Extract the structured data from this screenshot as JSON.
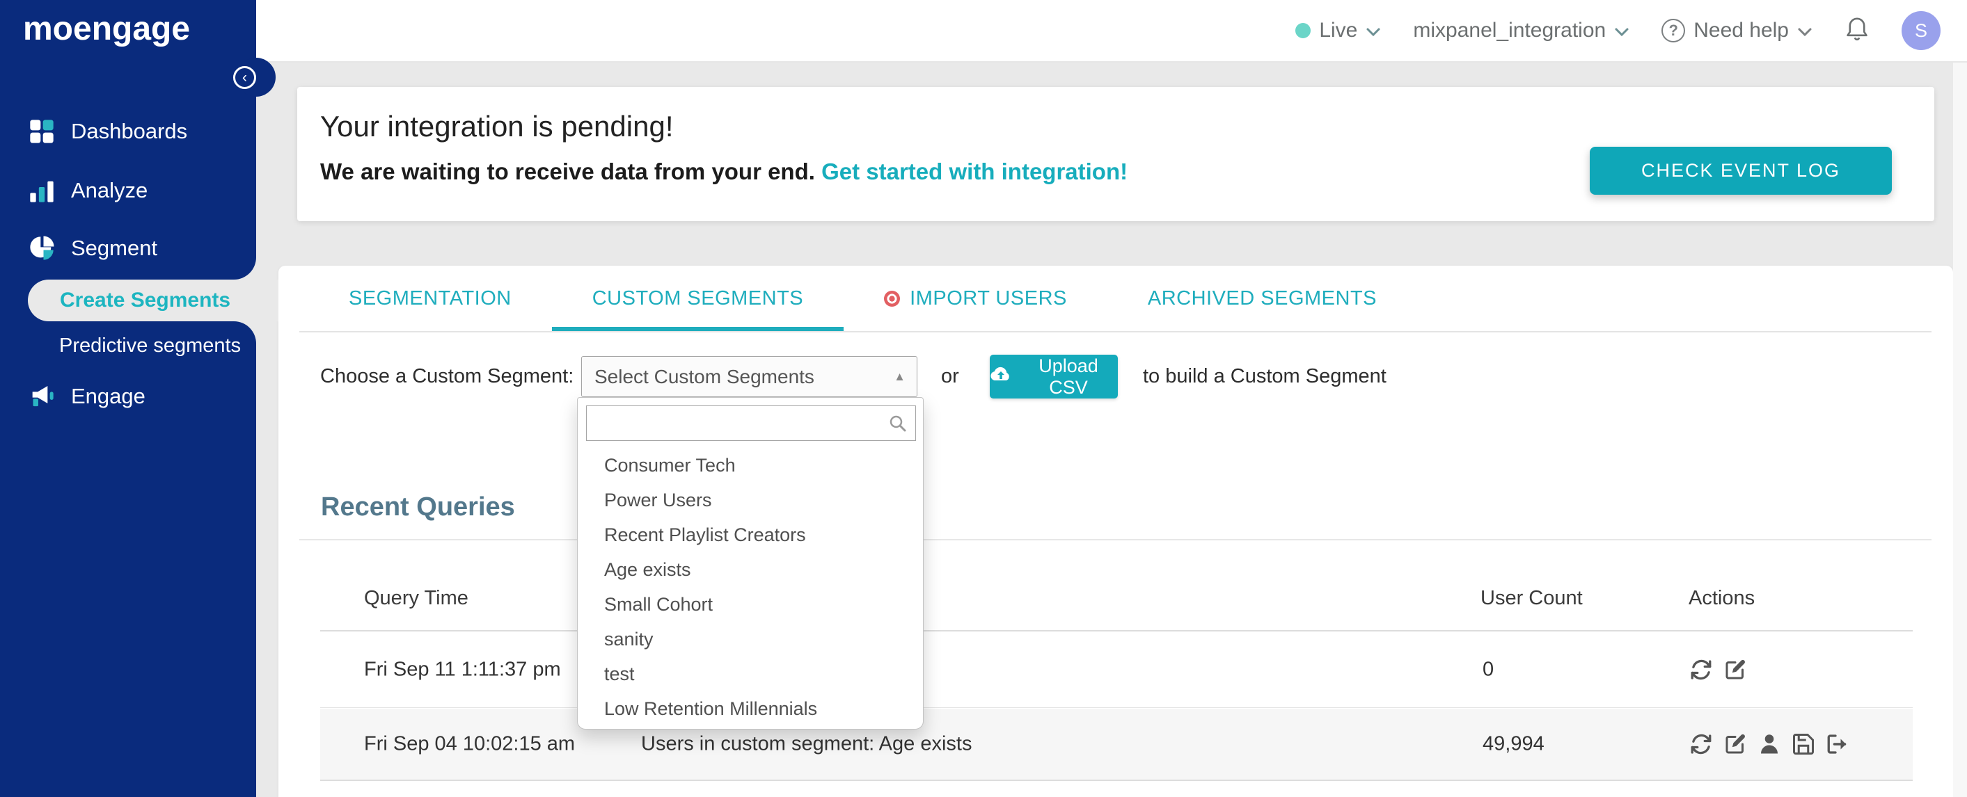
{
  "colors": {
    "sidebar_navy": "#0a2b7d",
    "accent_teal": "#17adbc",
    "button_teal": "#0fa7b8",
    "live_dot": "#6bd5c8",
    "avatar_bg": "#99a1ec",
    "alert_red": "#e25f62",
    "heading_slate": "#53788c"
  },
  "sidebar": {
    "logo_text": "moengage",
    "items": [
      {
        "label": "Dashboards",
        "icon": "dashboard-grid-icon"
      },
      {
        "label": "Analyze",
        "icon": "bar-chart-icon"
      },
      {
        "label": "Segment",
        "icon": "pie-chart-icon"
      }
    ],
    "segment_submenu": [
      {
        "label": "Create Segments",
        "active": true
      },
      {
        "label": "Predictive segments",
        "active": false
      }
    ],
    "items_bottom": [
      {
        "label": "Engage",
        "icon": "megaphone-icon"
      }
    ],
    "collapse_glyph": "‹"
  },
  "topbar": {
    "environment": "Live",
    "workspace": "mixpanel_integration",
    "help_label": "Need help",
    "help_glyph": "?",
    "avatar_initial": "S"
  },
  "banner": {
    "title": "Your integration is pending!",
    "message": "We are waiting to receive data from your end.",
    "link_text": "Get started with integration!",
    "button_label": "CHECK EVENT LOG"
  },
  "tabs": [
    {
      "label": "SEGMENTATION",
      "active": false,
      "has_alert_dot": false
    },
    {
      "label": "CUSTOM SEGMENTS",
      "active": true,
      "has_alert_dot": false
    },
    {
      "label": "IMPORT USERS",
      "active": false,
      "has_alert_dot": true
    },
    {
      "label": "ARCHIVED SEGMENTS",
      "active": false,
      "has_alert_dot": false
    }
  ],
  "picker": {
    "label": "Choose a Custom Segment:",
    "selected_value": "Select Custom Segments",
    "caret_glyph": "▲",
    "or_text": "or",
    "upload_label": "Upload CSV",
    "helper_text": "to build a Custom Segment",
    "search_value": "",
    "search_placeholder": "",
    "options": [
      "Consumer Tech",
      "Power Users",
      "Recent Playlist Creators",
      "Age exists",
      "Small Cohort",
      "sanity",
      "test",
      "Low Retention Millennials"
    ]
  },
  "recent_queries": {
    "heading": "Recent Queries",
    "columns": {
      "time": "Query Time",
      "count": "User Count",
      "actions": "Actions"
    },
    "rows": [
      {
        "time": "Fri Sep 11 1:11:37 pm",
        "description": "",
        "count": "0",
        "actions": [
          "refresh-icon",
          "edit-icon"
        ]
      },
      {
        "time": "Fri Sep 04 10:02:15 am",
        "description": "Users in custom segment: Age exists",
        "count": "49,994",
        "actions": [
          "refresh-icon",
          "edit-icon",
          "user-icon",
          "save-icon",
          "export-icon"
        ]
      }
    ]
  }
}
